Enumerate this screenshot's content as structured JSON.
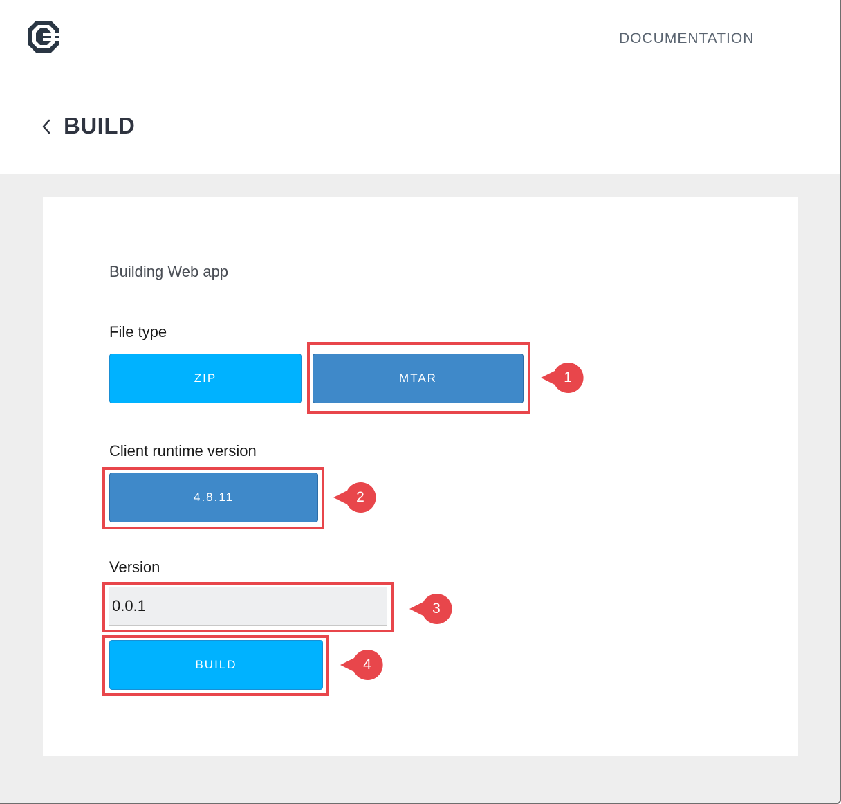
{
  "header": {
    "documentation_label": "DOCUMENTATION",
    "page_title": "BUILD"
  },
  "card": {
    "subtitle": "Building Web app",
    "file_type": {
      "label": "File type",
      "options": [
        "ZIP",
        "MTAR"
      ],
      "selected": "MTAR"
    },
    "runtime": {
      "label": "Client runtime version",
      "options": [
        "4.8.11"
      ],
      "selected": "4.8.11"
    },
    "version": {
      "label": "Version",
      "value": "0.0.1"
    },
    "build_button_label": "BUILD"
  },
  "callouts": [
    "1",
    "2",
    "3",
    "4"
  ],
  "colors": {
    "accent_cyan": "#00b2ff",
    "selected_blue": "#3f89c9",
    "highlight_red": "#e8464b",
    "title_dark": "#2f3440"
  }
}
